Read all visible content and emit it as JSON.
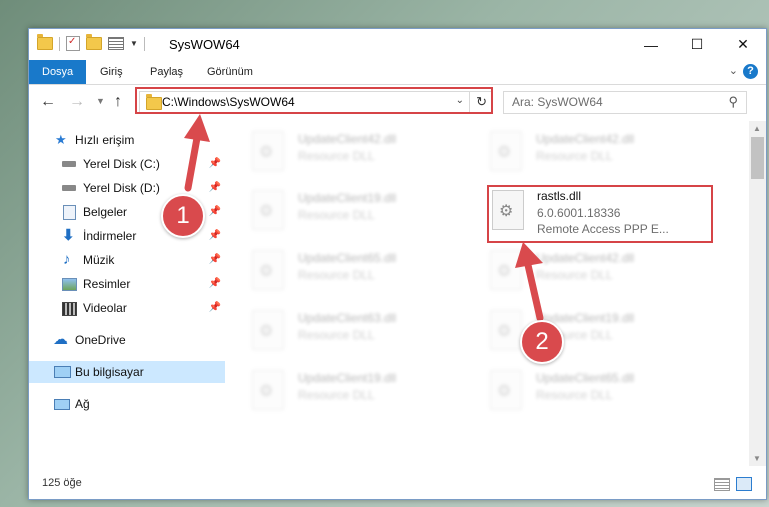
{
  "window": {
    "title": "SysWOW64",
    "controls": {
      "minimize": "—",
      "maximize": "☐",
      "close": "✕"
    }
  },
  "ribbon": {
    "tabs": [
      {
        "label": "Dosya",
        "active": true
      },
      {
        "label": "Giriş"
      },
      {
        "label": "Paylaş"
      },
      {
        "label": "Görünüm"
      }
    ],
    "help": "?"
  },
  "nav": {
    "address": "C:\\Windows\\SysWOW64",
    "search_placeholder": "Ara: SysWOW64"
  },
  "sidebar": {
    "items": [
      {
        "label": "Hızlı erişim",
        "icon": "star-icon"
      },
      {
        "label": "Yerel Disk (C:)",
        "icon": "drive-icon",
        "pinned": true
      },
      {
        "label": "Yerel Disk (D:)",
        "icon": "drive-icon",
        "pinned": true
      },
      {
        "label": "Belgeler",
        "icon": "documents-icon",
        "pinned": true
      },
      {
        "label": "İndirmeler",
        "icon": "download-icon",
        "pinned": true
      },
      {
        "label": "Müzik",
        "icon": "music-icon",
        "pinned": true
      },
      {
        "label": "Resimler",
        "icon": "pictures-icon",
        "pinned": true
      },
      {
        "label": "Videolar",
        "icon": "videos-icon",
        "pinned": true
      },
      {
        "label": "OneDrive",
        "icon": "cloud-icon"
      },
      {
        "label": "Bu bilgisayar",
        "icon": "computer-icon",
        "selected": true
      },
      {
        "label": "Ağ",
        "icon": "network-icon"
      }
    ]
  },
  "files": {
    "left": [
      {
        "name": "UpdateClient42.dll",
        "type": "Resource DLL"
      },
      {
        "name": "UpdateClient19.dll",
        "type": "Resource DLL"
      },
      {
        "name": "UpdateClient65.dll",
        "type": "Resource DLL"
      },
      {
        "name": "UpdateClient63.dll",
        "type": "Resource DLL"
      },
      {
        "name": "UpdateClient19.dll",
        "type": "Resource DLL"
      }
    ],
    "right": [
      {
        "name": "UpdateClient42.dll",
        "type": "Resource DLL"
      },
      {
        "name": "rastls.dll",
        "version": "6.0.6001.18336",
        "type": "Remote Access PPP E..."
      },
      {
        "name": "UpdateClient42.dll",
        "type": "Resource DLL"
      },
      {
        "name": "UpdateClient19.dll",
        "type": "Resource DLL"
      },
      {
        "name": "UpdateClient65.dll",
        "type": "Resource DLL"
      }
    ]
  },
  "status": {
    "count": "125 öğe"
  },
  "callouts": {
    "one": "1",
    "two": "2"
  },
  "colors": {
    "accent": "#1979ca",
    "highlight": "#d64447",
    "selected": "#cce8ff"
  }
}
